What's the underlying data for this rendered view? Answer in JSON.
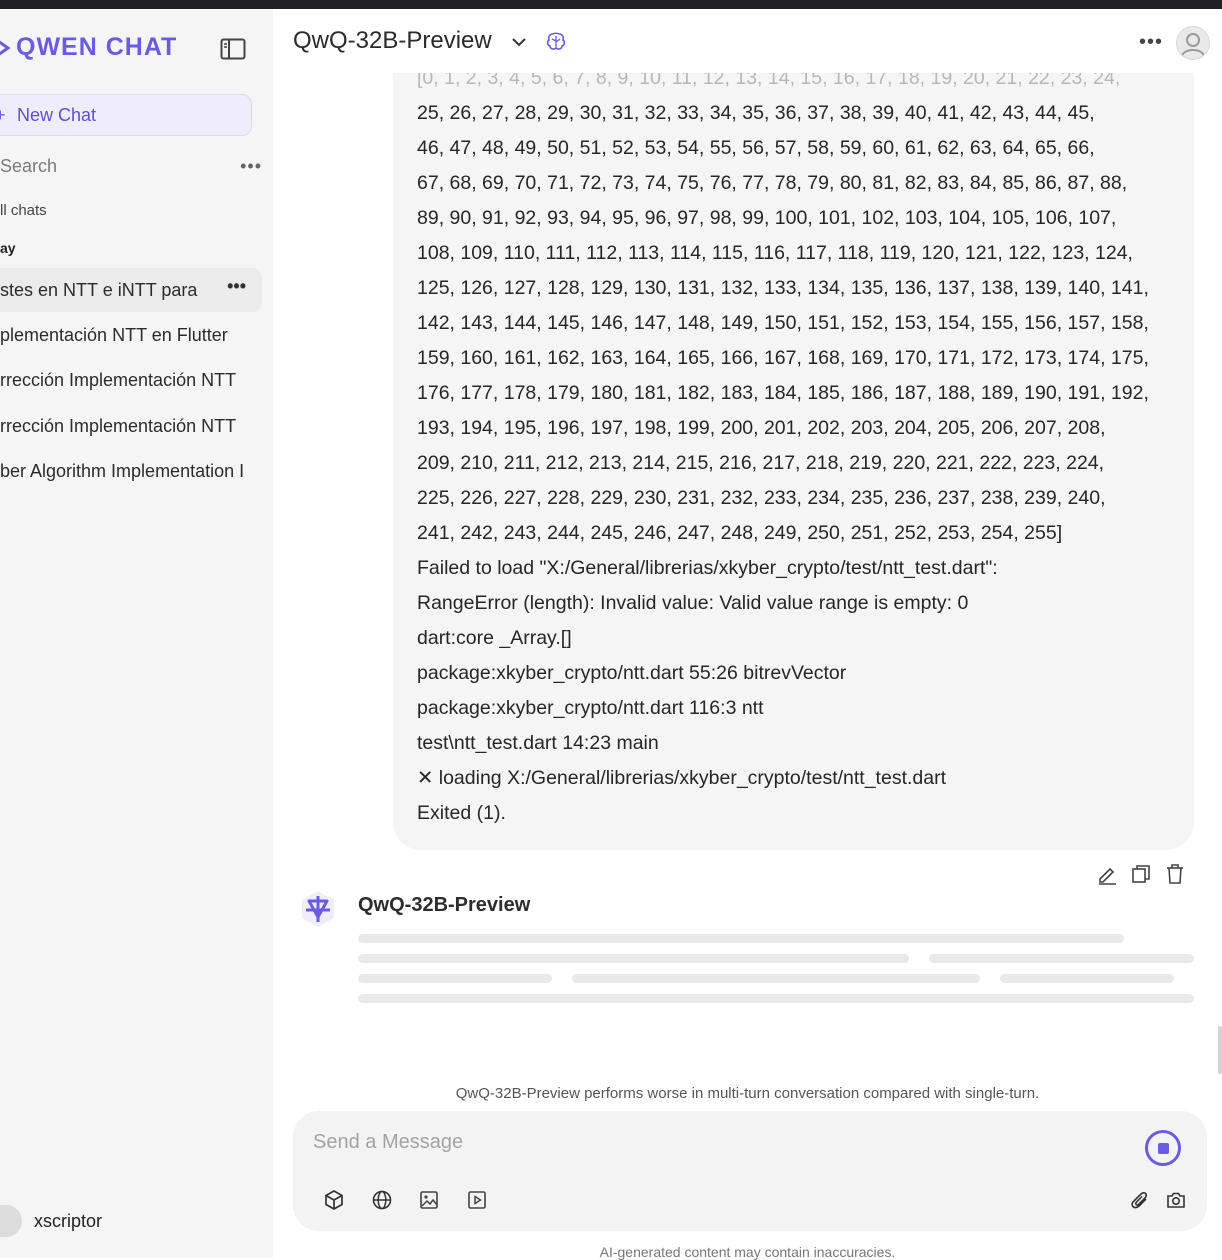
{
  "app": {
    "brand": "QWEN CHAT",
    "accent_color": "#6a5ce0",
    "icons": {
      "sidebar_toggle": "sidebar-toggle-icon",
      "model_select": "chevron-down-icon",
      "model_badge": "brain-icon",
      "more": "more-horizontal-icon"
    }
  },
  "sidebar": {
    "new_chat_label": "New Chat",
    "search_placeholder": "Search",
    "all_chats_label": "ll chats",
    "group_label": "ay",
    "chats": [
      {
        "title": "stes en NTT e iNTT para",
        "active": true
      },
      {
        "title": "plementación NTT en Flutter"
      },
      {
        "title": "rrección Implementación NTT"
      },
      {
        "title": "rrección Implementación NTT"
      },
      {
        "title": "ber Algorithm Implementation I"
      }
    ],
    "user_name": "xscriptor"
  },
  "header": {
    "model_name": "QwQ-32B-Preview"
  },
  "message": {
    "lines": [
      "[0, 1, 2, 3, 4, 5, 6, 7, 8, 9, 10, 11, 12, 13, 14, 15, 16, 17, 18, 19, 20, 21, 22, 23, 24,",
      "25, 26, 27, 28, 29, 30, 31, 32, 33, 34, 35, 36, 37, 38, 39, 40, 41, 42, 43, 44, 45,",
      "46, 47, 48, 49, 50, 51, 52, 53, 54, 55, 56, 57, 58, 59, 60, 61, 62, 63, 64, 65, 66,",
      "67, 68, 69, 70, 71, 72, 73, 74, 75, 76, 77, 78, 79, 80, 81, 82, 83, 84, 85, 86, 87, 88,",
      "89, 90, 91, 92, 93, 94, 95, 96, 97, 98, 99, 100, 101, 102, 103, 104, 105, 106, 107,",
      "108, 109, 110, 111, 112, 113, 114, 115, 116, 117, 118, 119, 120, 121, 122, 123, 124,",
      "125, 126, 127, 128, 129, 130, 131, 132, 133, 134, 135, 136, 137, 138, 139, 140, 141,",
      "142, 143, 144, 145, 146, 147, 148, 149, 150, 151, 152, 153, 154, 155, 156, 157, 158,",
      "159, 160, 161, 162, 163, 164, 165, 166, 167, 168, 169, 170, 171, 172, 173, 174, 175,",
      "176, 177, 178, 179, 180, 181, 182, 183, 184, 185, 186, 187, 188, 189, 190, 191, 192,",
      "193, 194, 195, 196, 197, 198, 199, 200, 201, 202, 203, 204, 205, 206, 207, 208,",
      "209, 210, 211, 212, 213, 214, 215, 216, 217, 218, 219, 220, 221, 222, 223, 224,",
      "225, 226, 227, 228, 229, 230, 231, 232, 233, 234, 235, 236, 237, 238, 239, 240,",
      "241, 242, 243, 244, 245, 246, 247, 248, 249, 250, 251, 252, 253, 254, 255]",
      "Failed to load \"X:/General/librerias/xkyber_crypto/test/ntt_test.dart\":",
      "RangeError (length): Invalid value: Valid value range is empty: 0",
      "dart:core _Array.[]",
      "package:xkyber_crypto/ntt.dart 55:26 bitrevVector",
      "package:xkyber_crypto/ntt.dart 116:3 ntt",
      "test\\ntt_test.dart 14:23 main",
      "✕ loading X:/General/librerias/xkyber_crypto/test/ntt_test.dart",
      "Exited (1)."
    ]
  },
  "assistant": {
    "name": "QwQ-32B-Preview"
  },
  "composer": {
    "placeholder": "Send a Message",
    "disclaimer": "QwQ-32B-Preview performs worse in multi-turn conversation compared with single-turn.",
    "footer": "AI-generated content may contain inaccuracies."
  }
}
